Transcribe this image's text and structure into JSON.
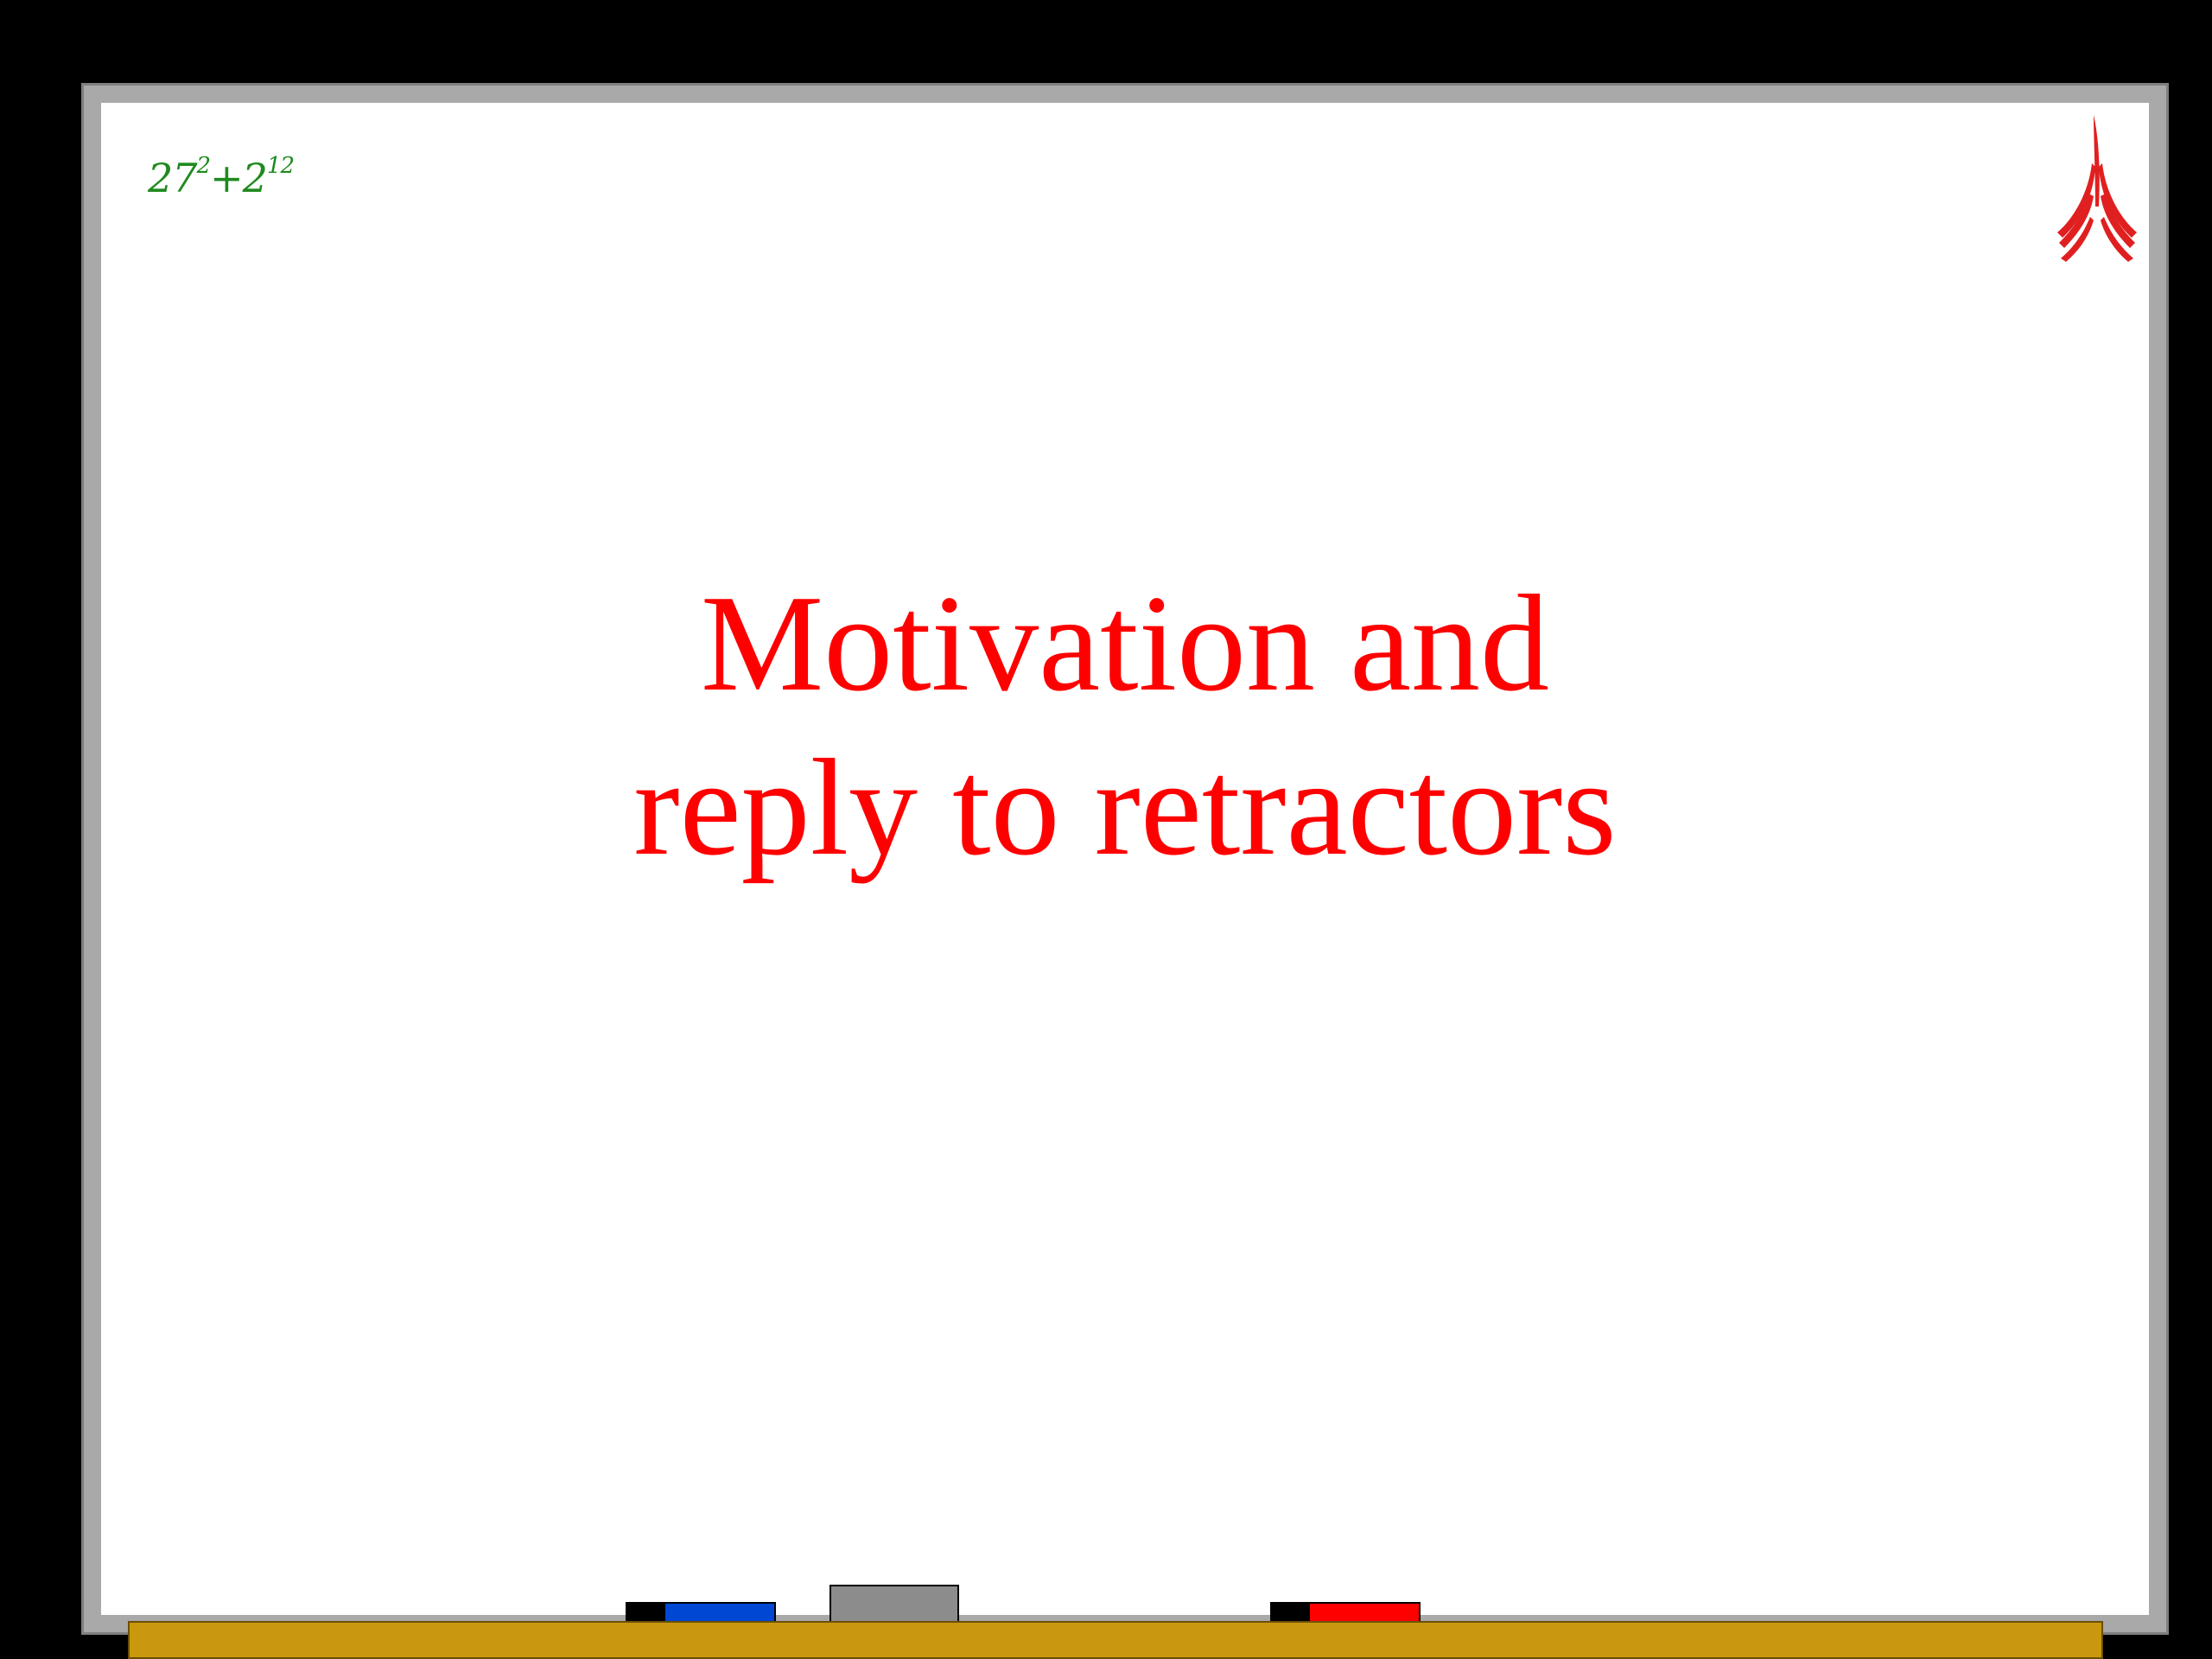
{
  "slide": {
    "title_line1": "Motivation and",
    "title_line2": "reply to retractors",
    "title_color": "#ff0000"
  },
  "formula": {
    "base1": "27",
    "exp1": "2",
    "operator": "+",
    "base2": "2",
    "exp2": "12",
    "color": "#1f8a1f"
  },
  "logo": {
    "icon": "red-flame-logo-icon",
    "color": "#e02020"
  },
  "whiteboard": {
    "frame_color": "#a9a9a9",
    "surface_color": "#ffffff",
    "tray_color": "#c9980e"
  },
  "markers": [
    {
      "name": "blue-marker",
      "color": "#0047d4"
    },
    {
      "name": "red-marker",
      "color": "#ff0000"
    }
  ],
  "eraser": {
    "color": "#8c8c8c"
  }
}
